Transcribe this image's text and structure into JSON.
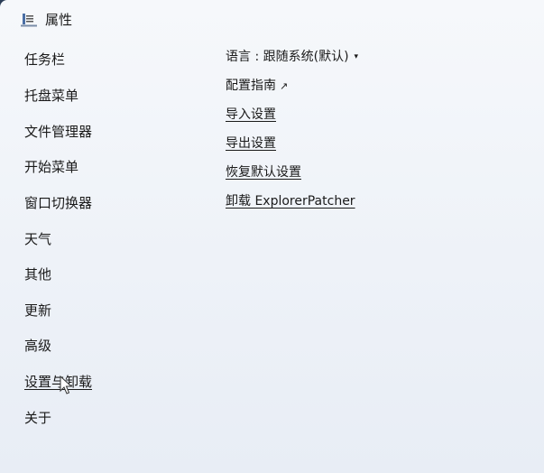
{
  "window": {
    "title": "属性",
    "icon": "properties-icon"
  },
  "sidebar": {
    "items": [
      {
        "label": "任务栏"
      },
      {
        "label": "托盘菜单"
      },
      {
        "label": "文件管理器"
      },
      {
        "label": "开始菜单"
      },
      {
        "label": "窗口切换器"
      },
      {
        "label": "天气"
      },
      {
        "label": "其他"
      },
      {
        "label": "更新"
      },
      {
        "label": "高级"
      },
      {
        "label": "设置与卸载",
        "active": true
      },
      {
        "label": "关于"
      }
    ]
  },
  "content": {
    "language_label": "语言 : 跟随系统(默认)",
    "language_caret": "▾",
    "guide_label": "配置指南",
    "guide_arrow": "↗",
    "import_label": "导入设置",
    "export_label": "导出设置",
    "restore_label": "恢复默认设置",
    "uninstall_label": "卸载 ExplorerPatcher"
  },
  "colors": {
    "text": "#1a1a1a",
    "background": "#f3f6fa"
  }
}
